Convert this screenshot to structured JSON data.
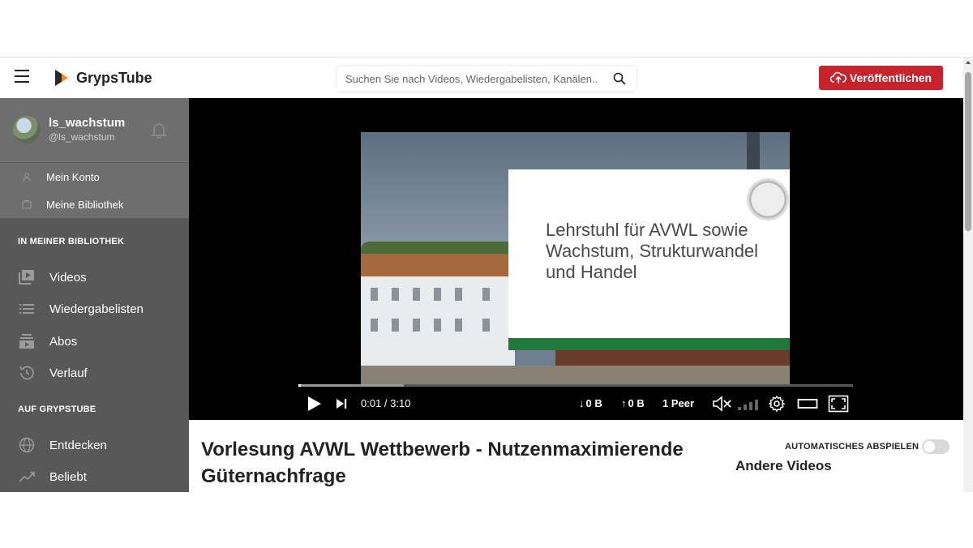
{
  "header": {
    "app_name": "GrypsTube",
    "search_placeholder": "Suchen Sie nach Videos, Wiedergabelisten, Kanälen..",
    "publish_label": "Veröffentlichen",
    "accent_color": "#c8232d"
  },
  "sidebar": {
    "user": {
      "name": "ls_wachstum",
      "handle": "@ls_wachstum"
    },
    "account_links": [
      {
        "label": "Mein Konto",
        "icon": "user-icon"
      },
      {
        "label": "Meine Bibliothek",
        "icon": "library-icon"
      }
    ],
    "library_section": {
      "title": "IN MEINER BIBLIOTHEK",
      "items": [
        {
          "label": "Videos",
          "icon": "video-library-icon"
        },
        {
          "label": "Wiedergabelisten",
          "icon": "playlist-icon"
        },
        {
          "label": "Abos",
          "icon": "subscriptions-icon"
        },
        {
          "label": "Verlauf",
          "icon": "history-icon"
        }
      ]
    },
    "site_section": {
      "title": "AUF GRYPSTUBE",
      "items": [
        {
          "label": "Entdecken",
          "icon": "globe-icon"
        },
        {
          "label": "Beliebt",
          "icon": "trending-icon"
        }
      ]
    }
  },
  "player": {
    "slide_text": "Lehrstuhl für AVWL sowie Wachstum, Strukturwandel und Handel",
    "current_time": "0:01",
    "duration": "3:10",
    "time_separator": " / ",
    "download": "0 B",
    "upload": "0 B",
    "peers": "1 Peer",
    "played_fraction": 0.005,
    "buffered_fraction": 0.19
  },
  "video": {
    "title": "Vorlesung AVWL Wettbewerb - Nutzenmaximierende Güternachfrage"
  },
  "aside": {
    "autoplay_label": "AUTOMATISCHES ABSPIELEN",
    "autoplay_on": false,
    "other_videos_title": "Andere Videos"
  }
}
